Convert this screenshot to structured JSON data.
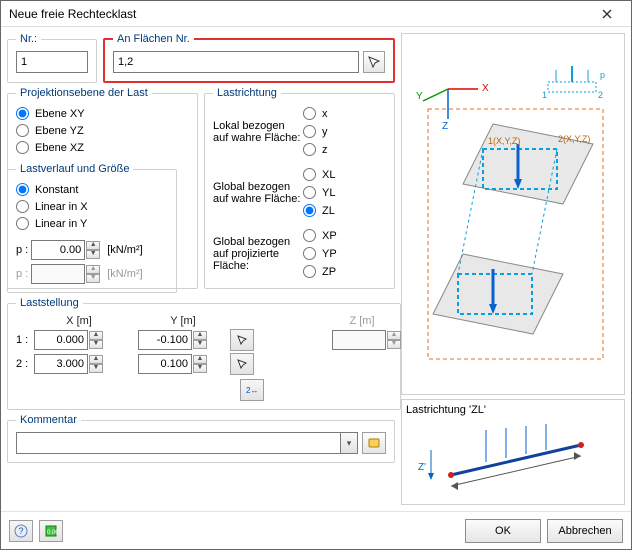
{
  "window": {
    "title": "Neue freie Rechtecklast"
  },
  "nr": {
    "legend": "Nr.:",
    "value": "1"
  },
  "surfaces": {
    "legend": "An Flächen Nr.",
    "value": "1,2"
  },
  "projection": {
    "legend": "Projektionsebene der Last",
    "options": [
      "Ebene XY",
      "Ebene YZ",
      "Ebene XZ"
    ],
    "selected": 0
  },
  "distribution": {
    "legend": "Lastverlauf und Größe",
    "options": [
      "Konstant",
      "Linear in X",
      "Linear in Y"
    ],
    "selected": 0,
    "p_label": "p :",
    "p_value": "0.00",
    "p_unit": "[kN/m²]",
    "p2_label": "p :",
    "p2_value": "",
    "p2_unit": "[kN/m²]"
  },
  "direction": {
    "legend": "Lastrichtung",
    "group1_label": "Lokal bezogen auf wahre Fläche:",
    "group1": [
      "x",
      "y",
      "z"
    ],
    "group2_label": "Global bezogen auf wahre Fläche:",
    "group2": [
      "XL",
      "YL",
      "ZL"
    ],
    "group2_selected": 2,
    "group3_label": "Global bezogen auf projizierte Fläche:",
    "group3": [
      "XP",
      "YP",
      "ZP"
    ]
  },
  "position": {
    "legend": "Laststellung",
    "col_x": "X",
    "unit_x": "[m]",
    "col_y": "Y",
    "unit_y": "[m]",
    "col_z": "Z",
    "unit_z": "[m]",
    "row1_label": "1 :",
    "row1_x": "0.000",
    "row1_y": "-0.100",
    "row2_label": "2 :",
    "row2_x": "3.000",
    "row2_y": "0.100"
  },
  "comment": {
    "legend": "Kommentar",
    "value": ""
  },
  "direction_preview": {
    "caption": "Lastrichtung 'ZL'"
  },
  "buttons": {
    "ok": "OK",
    "cancel": "Abbrechen"
  },
  "chart_data": {
    "type": "diagram",
    "axes": [
      "X",
      "Y",
      "Z'"
    ],
    "description": "3D preview of free rectangular load on surfaces with global axis triad and load direction ZL illustration"
  }
}
